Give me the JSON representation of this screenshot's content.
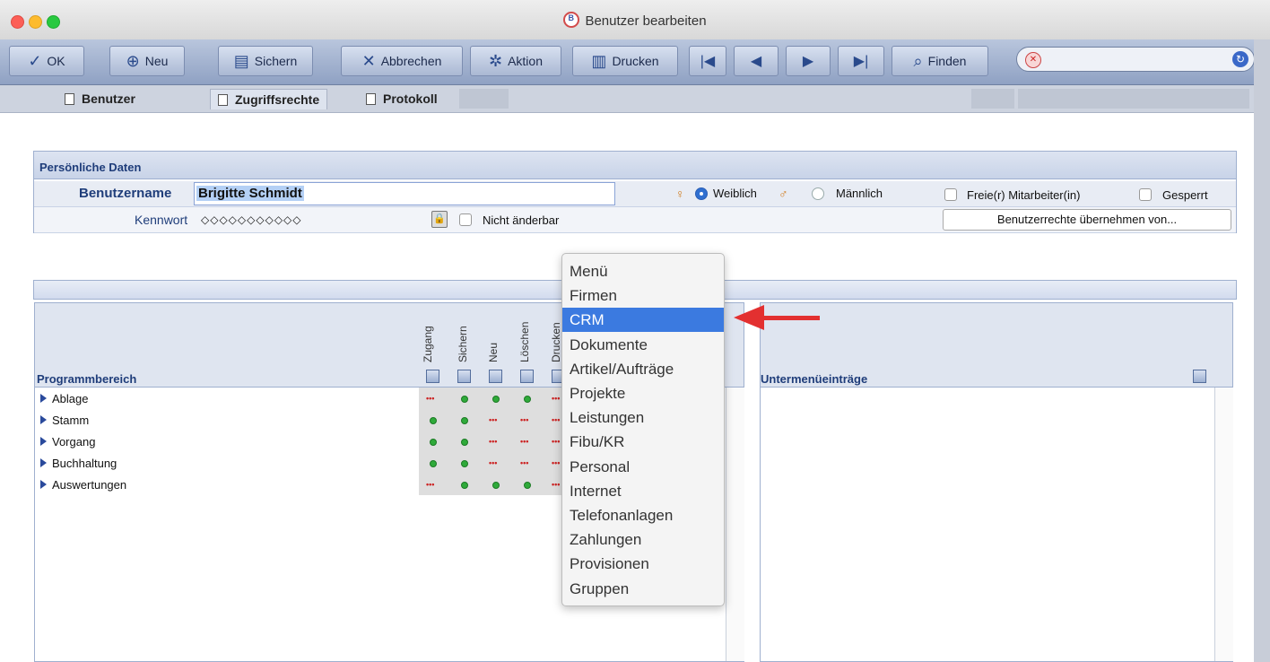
{
  "window": {
    "title": "Benutzer bearbeiten",
    "traffic_lights": [
      "#fc5f57",
      "#fdbb2e",
      "#29c940"
    ]
  },
  "toolbar": {
    "ok": "OK",
    "new": "Neu",
    "save": "Sichern",
    "cancel": "Abbrechen",
    "action": "Aktion",
    "print": "Drucken",
    "find": "Finden",
    "search_value": ""
  },
  "tabs": [
    "Benutzer",
    "Zugriffsrechte",
    "Protokoll"
  ],
  "personal": {
    "section_title": "Persönliche Daten",
    "username_label": "Benutzername",
    "username_value": "Brigitte Schmidt",
    "gender_female": "Weiblich",
    "gender_male": "Männlich",
    "gender_selected": "Weiblich",
    "freelancer_label": "Freie(r) Mitarbeiter(in)",
    "locked_label": "Gesperrt",
    "password_label": "Kennwort",
    "password_value": "◇◇◇◇◇◇◇◇◇◇◇",
    "unchangeable_label": "Nicht änderbar",
    "copy_rights_button": "Benutzerrechte übernehmen von..."
  },
  "rights": {
    "section_title": "Programmbereich",
    "columns": [
      "Zugang",
      "Sichern",
      "Neu",
      "Löschen",
      "Drucken"
    ],
    "rows": [
      {
        "name": "Ablage",
        "cells": [
          "dash",
          "dot",
          "dot",
          "dot",
          "dash"
        ]
      },
      {
        "name": "Stamm",
        "cells": [
          "dot",
          "dot",
          "dash",
          "dash",
          "dash"
        ]
      },
      {
        "name": "Vorgang",
        "cells": [
          "dot",
          "dot",
          "dash",
          "dash",
          "dash"
        ]
      },
      {
        "name": "Buchhaltung",
        "cells": [
          "dot",
          "dot",
          "dash",
          "dash",
          "dash"
        ]
      },
      {
        "name": "Auswertungen",
        "cells": [
          "dash",
          "dot",
          "dot",
          "dot",
          "dash"
        ]
      }
    ]
  },
  "submenu": {
    "title": "Untermenüeinträge"
  },
  "dropdown": {
    "items": [
      "Menü",
      "Firmen",
      "CRM",
      "Dokumente",
      "Artikel/Aufträge",
      "Projekte",
      "Leistungen",
      "Fibu/KR",
      "Personal",
      "Internet",
      "Telefonanlagen",
      "Zahlungen",
      "Provisionen",
      "Gruppen"
    ],
    "selected": "CRM"
  },
  "annotation_color": "#e33030"
}
